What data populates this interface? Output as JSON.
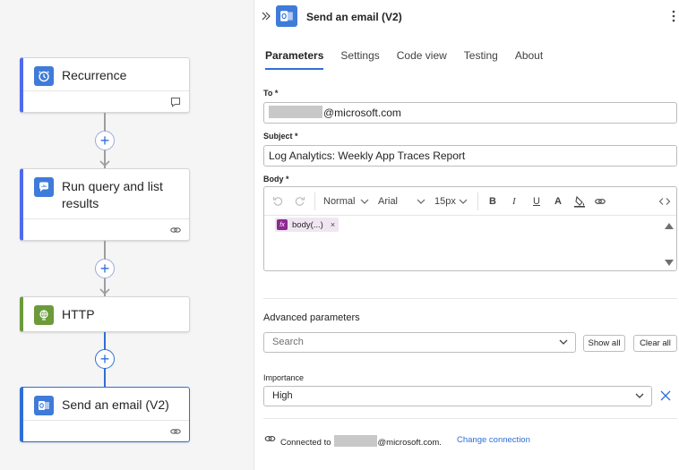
{
  "canvas": {
    "cards": [
      {
        "title": "Recurrence",
        "icon": "clock-icon",
        "color": "#3f7bd9"
      },
      {
        "title": "Run query and list results",
        "icon": "log-analytics-icon",
        "color": "#3f7bd9"
      },
      {
        "title": "HTTP",
        "icon": "globe-icon",
        "color": "#6b9b3a"
      },
      {
        "title": "Send an email (V2)",
        "icon": "outlook-icon",
        "color": "#3f7bd9",
        "selected": true
      }
    ],
    "add_step_symbol": "+"
  },
  "panel": {
    "title": "Send an email (V2)",
    "tabs": [
      "Parameters",
      "Settings",
      "Code view",
      "Testing",
      "About"
    ],
    "active_tab": "Parameters",
    "fields": {
      "to_label": "To *",
      "to_value": "@microsoft.com",
      "subject_label": "Subject *",
      "subject_value": "Log Analytics: Weekly App Traces Report",
      "body_label": "Body *"
    },
    "editor": {
      "style": "Normal",
      "font": "Arial",
      "size": "15px",
      "bold": "B",
      "italic": "I",
      "underline": "U",
      "font_color": "A",
      "token_fx": "fx",
      "token_label": "body(...)",
      "token_remove": "×"
    },
    "advanced": {
      "title": "Advanced parameters",
      "search_placeholder": "Search",
      "show_all": "Show all",
      "clear_all": "Clear all"
    },
    "importance": {
      "label": "Importance",
      "value": "High"
    },
    "connection": {
      "prefix": "Connected to",
      "suffix": "@microsoft.com.",
      "change_link": "Change connection"
    },
    "accent": "#2f6fd6"
  }
}
